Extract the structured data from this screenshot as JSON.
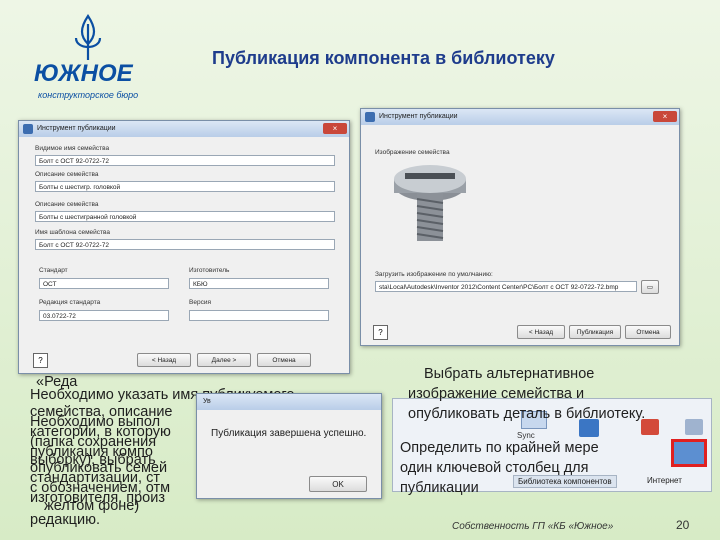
{
  "slide": {
    "title": "Публикация компонента в библиотеку",
    "logo_word": "ЮЖНОЕ",
    "logo_sub": "конструкторское бюро",
    "footer": "Собственность ГП «КБ «Южное»",
    "page": "20"
  },
  "dialog1": {
    "title": "Инструмент публикации",
    "close": "×",
    "label_family_name": "Видимое имя семейства",
    "value_family_name": "Болт с ОСТ 92-0722-72",
    "label_family_desc": "Описание семейства",
    "value_family_desc": "Болты с шестигр. головкой",
    "label_desc": "Описание семейства",
    "value_desc": "Болты с шестигранной головкой",
    "label_template": "Имя шаблона семейства",
    "value_template": "Болт с ОСТ 92-0722-72",
    "label_standard": "Стандарт",
    "value_standard": "ОСТ",
    "label_manufacturer": "Изготовитель",
    "value_manufacturer": "КБЮ",
    "label_edition": "Редакция стандарта",
    "value_edition": "03.0722-72",
    "label_revision": "Версия",
    "value_revision": "",
    "help": "?",
    "btn_back": "< Назад",
    "btn_next": "Далее >",
    "btn_cancel": "Отмена"
  },
  "dialog2": {
    "title": "Инструмент публикации",
    "close": "×",
    "label_image": "Изображение семейства",
    "label_path": "Загрузить изображение по умолчанию:",
    "value_path": "sta\\Local\\Autodesk\\Inventor 2012\\Content Center\\PC\\Болт с ОСТ 92-0722-72.bmp",
    "help": "?",
    "btn_back": "< Назад",
    "btn_publish": "Публикация",
    "btn_cancel": "Отмена"
  },
  "alert": {
    "title": "Ув",
    "message": "Публикация завершена успешно.",
    "ok": "OK"
  },
  "ribbon": {
    "item": "Sync",
    "tab_library": "Библиотека компонентов",
    "tab_internet": "Интернет"
  },
  "text_left": {
    "line1": "«Реда",
    "line2": "Необходимо указать имя публикуемого",
    "line3": "семейства, описание",
    "line4": "Необходимо выпол",
    "line5": "категории, в которую",
    "line6": "(папка сохранения",
    "line7": "публикация компо",
    "line8": "выборку), выбрать",
    "line9": "опубликовать семей",
    "line10": "стандартизации, ст",
    "line11": "с обозначением, отм",
    "line12": "изготовителя, произ",
    "line13": "желтом фоне)",
    "line14": "редакцию."
  },
  "text_right": {
    "line1": "Выбрать альтернативное",
    "line2": "изображение семейства и",
    "line3": "опубликовать деталь в библиотеку.",
    "line4": "Определить по крайней мере",
    "line5": "один ключевой столбец для",
    "line6": "публикации"
  },
  "colors": {
    "title": "#1e3c8c",
    "logo": "#0b4fa3",
    "highlight": "#e02020"
  }
}
